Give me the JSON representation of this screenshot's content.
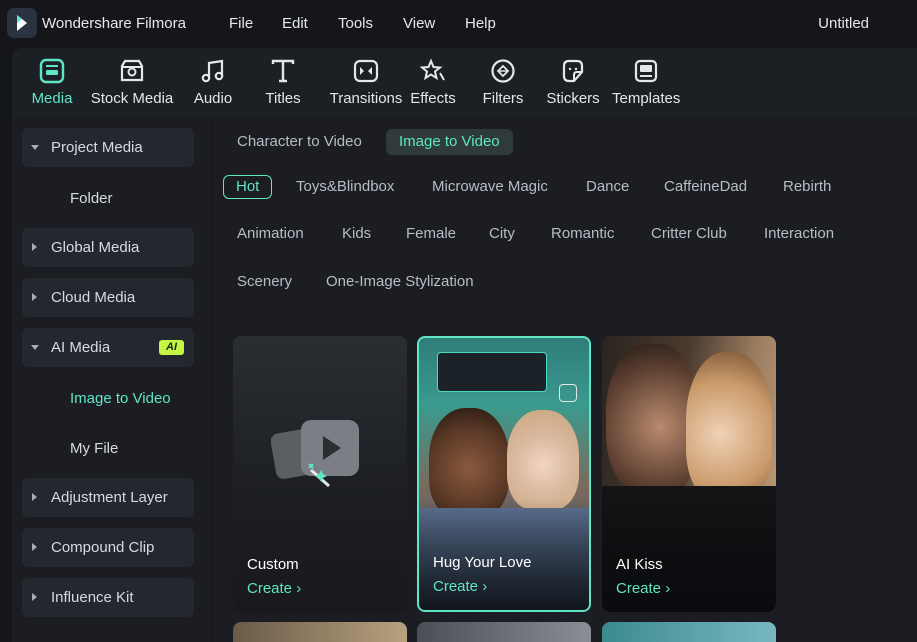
{
  "app": {
    "name": "Wondershare Filmora",
    "document_title": "Untitled"
  },
  "menu": [
    "File",
    "Edit",
    "Tools",
    "View",
    "Help"
  ],
  "toolbar": [
    {
      "label": "Media",
      "icon": "media-icon",
      "active": true
    },
    {
      "label": "Stock Media",
      "icon": "stock-media-icon"
    },
    {
      "label": "Audio",
      "icon": "music-note-icon"
    },
    {
      "label": "Titles",
      "icon": "text-t-icon"
    },
    {
      "label": "Transitions",
      "icon": "transitions-icon"
    },
    {
      "label": "Effects",
      "icon": "effects-star-icon"
    },
    {
      "label": "Filters",
      "icon": "filters-icon"
    },
    {
      "label": "Stickers",
      "icon": "sticker-icon"
    },
    {
      "label": "Templates",
      "icon": "templates-icon"
    }
  ],
  "sidebar": {
    "items": [
      {
        "label": "Project Media",
        "expanded": true
      },
      {
        "label": "Folder",
        "sub": true
      },
      {
        "label": "Global Media"
      },
      {
        "label": "Cloud Media"
      },
      {
        "label": "AI Media",
        "expanded": true,
        "badge": "AI"
      },
      {
        "label": "Image to Video",
        "sub": true,
        "active": true
      },
      {
        "label": "My File",
        "sub": true
      },
      {
        "label": "Adjustment Layer"
      },
      {
        "label": "Compound Clip"
      },
      {
        "label": "Influence Kit"
      }
    ]
  },
  "tabs": [
    {
      "label": "Character to Video"
    },
    {
      "label": "Image to Video",
      "active": true
    }
  ],
  "categories": [
    "Hot",
    "Toys&Blindbox",
    "Microwave Magic",
    "Dance",
    "CaffeineDad",
    "Rebirth",
    "Animation",
    "Kids",
    "Female",
    "City",
    "Romantic",
    "Critter Club",
    "Interaction",
    "Scenery",
    "One-Image Stylization"
  ],
  "active_category": "Hot",
  "cards": [
    {
      "title": "Custom",
      "action": "Create"
    },
    {
      "title": "Hug Your Love",
      "action": "Create",
      "selected": true
    },
    {
      "title": "AI Kiss",
      "action": "Create"
    }
  ],
  "colors": {
    "accent": "#5fe6c3",
    "ai_badge": "#c5f545",
    "background": "#1b1d22"
  }
}
